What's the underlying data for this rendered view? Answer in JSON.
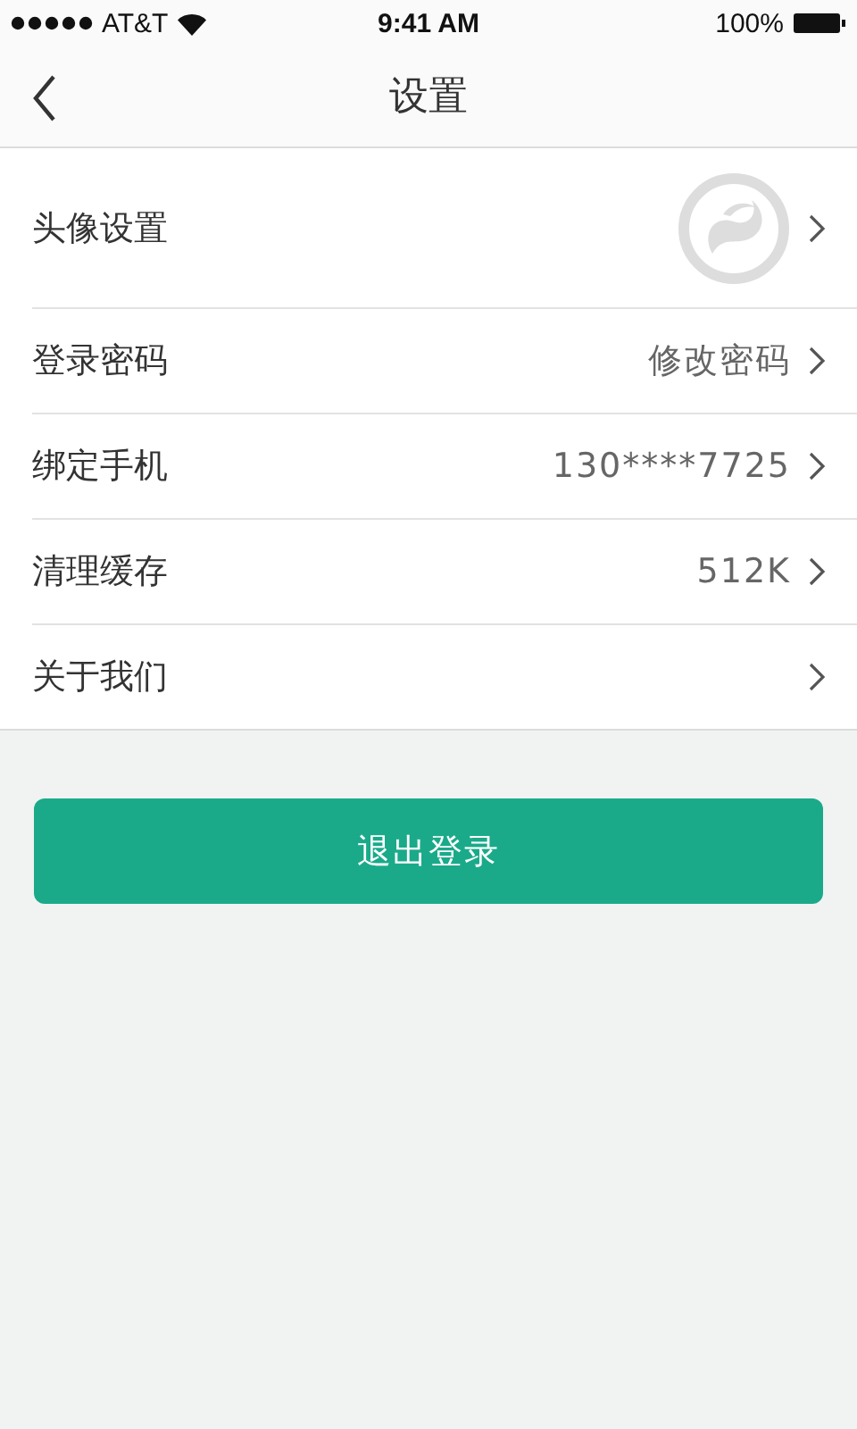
{
  "status_bar": {
    "carrier": "AT&T",
    "time": "9:41 AM",
    "battery": "100%"
  },
  "nav": {
    "title": "设置"
  },
  "rows": [
    {
      "kind": "avatar",
      "label": "头像设置"
    },
    {
      "kind": "value",
      "label": "登录密码",
      "value": "修改密码"
    },
    {
      "kind": "value",
      "label": "绑定手机",
      "value": "130****7725"
    },
    {
      "kind": "value",
      "label": "清理缓存",
      "value": "512K"
    },
    {
      "kind": "value",
      "label": "关于我们"
    }
  ],
  "logout_button": "退出登录"
}
